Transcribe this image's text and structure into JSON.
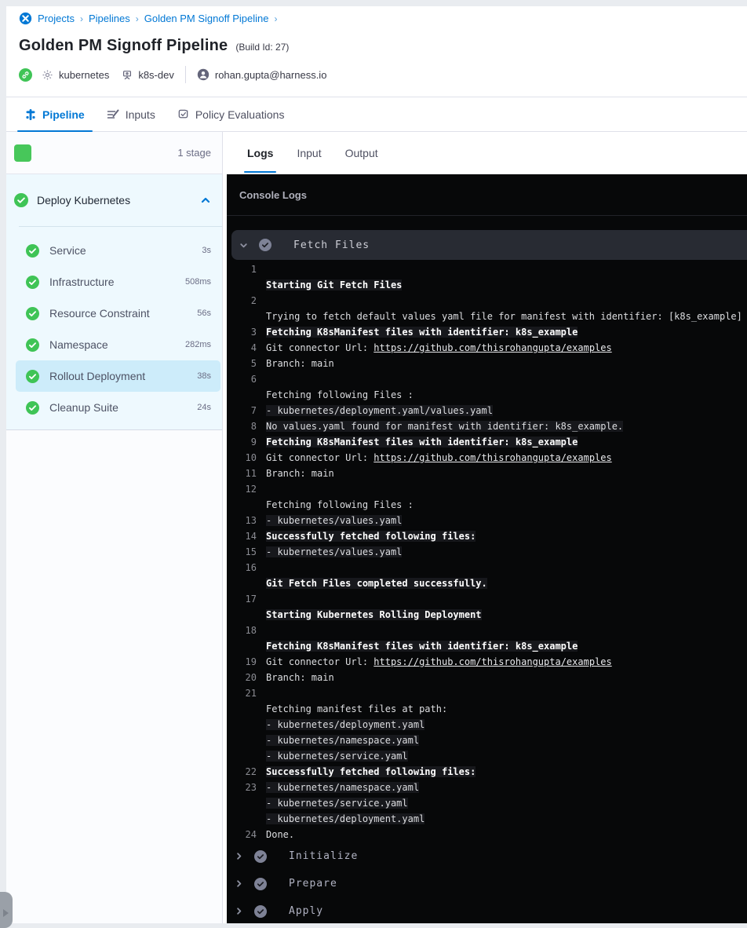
{
  "breadcrumb": {
    "separator": "›",
    "items": [
      "Projects",
      "Pipelines",
      "Golden PM Signoff Pipeline"
    ]
  },
  "header": {
    "title": "Golden PM Signoff Pipeline",
    "build_id": "(Build Id: 27)",
    "service": "kubernetes",
    "environment": "k8s-dev",
    "user": "rohan.gupta@harness.io"
  },
  "tabs": [
    {
      "label": "Pipeline",
      "active": true
    },
    {
      "label": "Inputs",
      "active": false
    },
    {
      "label": "Policy Evaluations",
      "active": false
    }
  ],
  "execution": {
    "stage_count_label": "1 stage"
  },
  "sidebar": {
    "stage_name": "Deploy Kubernetes",
    "stage_status": "success",
    "steps": [
      {
        "label": "Service",
        "duration": "3s",
        "status": "success",
        "selected": false
      },
      {
        "label": "Infrastructure",
        "duration": "508ms",
        "status": "success",
        "selected": false
      },
      {
        "label": "Resource Constraint",
        "duration": "56s",
        "status": "success",
        "selected": false
      },
      {
        "label": "Namespace",
        "duration": "282ms",
        "status": "success",
        "selected": false
      },
      {
        "label": "Rollout Deployment",
        "duration": "38s",
        "status": "success",
        "selected": true
      },
      {
        "label": "Cleanup Suite",
        "duration": "24s",
        "status": "success",
        "selected": false
      }
    ]
  },
  "log_tabs": [
    {
      "label": "Logs",
      "active": true
    },
    {
      "label": "Input",
      "active": false
    },
    {
      "label": "Output",
      "active": false
    }
  ],
  "console": {
    "title": "Console Logs",
    "sections": [
      {
        "label": "Fetch Files",
        "state": "expanded",
        "status": "success",
        "lines": [
          {
            "n": "1",
            "seg": []
          },
          {
            "n": "",
            "seg": [
              {
                "s": "b",
                "t": "Starting Git Fetch Files"
              }
            ]
          },
          {
            "n": "2",
            "seg": []
          },
          {
            "n": "",
            "seg": [
              {
                "s": "p",
                "t": "Trying to fetch default values yaml file for manifest with identifier: [k8s_example]"
              }
            ]
          },
          {
            "n": "3",
            "seg": [
              {
                "s": "b",
                "t": "Fetching K8sManifest files with identifier: k8s_example"
              }
            ]
          },
          {
            "n": "4",
            "seg": [
              {
                "s": "p",
                "t": "Git connector Url: "
              },
              {
                "s": "l",
                "t": "https://github.com/thisrohangupta/examples"
              }
            ]
          },
          {
            "n": "5",
            "seg": [
              {
                "s": "p",
                "t": "Branch: main"
              }
            ]
          },
          {
            "n": "6",
            "seg": []
          },
          {
            "n": "",
            "seg": [
              {
                "s": "p",
                "t": "Fetching following Files :"
              }
            ]
          },
          {
            "n": "7",
            "seg": [
              {
                "s": "h",
                "t": "- kubernetes/deployment.yaml/values.yaml"
              }
            ]
          },
          {
            "n": "8",
            "seg": [
              {
                "s": "h",
                "t": "No values.yaml found for manifest with identifier: k8s_example."
              }
            ]
          },
          {
            "n": "9",
            "seg": [
              {
                "s": "b",
                "t": "Fetching K8sManifest files with identifier: k8s_example"
              }
            ]
          },
          {
            "n": "10",
            "seg": [
              {
                "s": "p",
                "t": "Git connector Url: "
              },
              {
                "s": "l",
                "t": "https://github.com/thisrohangupta/examples"
              }
            ]
          },
          {
            "n": "11",
            "seg": [
              {
                "s": "p",
                "t": "Branch: main"
              }
            ]
          },
          {
            "n": "12",
            "seg": []
          },
          {
            "n": "",
            "seg": [
              {
                "s": "p",
                "t": "Fetching following Files :"
              }
            ]
          },
          {
            "n": "13",
            "seg": [
              {
                "s": "h",
                "t": "- kubernetes/values.yaml"
              }
            ]
          },
          {
            "n": "14",
            "seg": [
              {
                "s": "b",
                "t": "Successfully fetched following files:"
              }
            ]
          },
          {
            "n": "15",
            "seg": [
              {
                "s": "h",
                "t": "- kubernetes/values.yaml"
              }
            ]
          },
          {
            "n": "16",
            "seg": []
          },
          {
            "n": "",
            "seg": [
              {
                "s": "b",
                "t": "Git Fetch Files completed successfully."
              }
            ]
          },
          {
            "n": "17",
            "seg": []
          },
          {
            "n": "",
            "seg": [
              {
                "s": "b",
                "t": "Starting Kubernetes Rolling Deployment"
              }
            ]
          },
          {
            "n": "18",
            "seg": []
          },
          {
            "n": "",
            "seg": [
              {
                "s": "b",
                "t": "Fetching K8sManifest files with identifier: k8s_example"
              }
            ]
          },
          {
            "n": "19",
            "seg": [
              {
                "s": "p",
                "t": "Git connector Url: "
              },
              {
                "s": "l",
                "t": "https://github.com/thisrohangupta/examples"
              }
            ]
          },
          {
            "n": "20",
            "seg": [
              {
                "s": "p",
                "t": "Branch: main"
              }
            ]
          },
          {
            "n": "21",
            "seg": []
          },
          {
            "n": "",
            "seg": [
              {
                "s": "p",
                "t": "Fetching manifest files at path:"
              }
            ]
          },
          {
            "n": "",
            "seg": [
              {
                "s": "h",
                "t": "- kubernetes/deployment.yaml"
              }
            ]
          },
          {
            "n": "",
            "seg": [
              {
                "s": "h",
                "t": "- kubernetes/namespace.yaml"
              }
            ]
          },
          {
            "n": "",
            "seg": [
              {
                "s": "h",
                "t": "- kubernetes/service.yaml"
              }
            ]
          },
          {
            "n": "22",
            "seg": [
              {
                "s": "b",
                "t": "Successfully fetched following files:"
              }
            ]
          },
          {
            "n": "23",
            "seg": [
              {
                "s": "h",
                "t": "- kubernetes/namespace.yaml"
              }
            ]
          },
          {
            "n": "",
            "seg": [
              {
                "s": "h",
                "t": "- kubernetes/service.yaml"
              }
            ]
          },
          {
            "n": "",
            "seg": [
              {
                "s": "h",
                "t": "- kubernetes/deployment.yaml"
              }
            ]
          },
          {
            "n": "24",
            "seg": [
              {
                "s": "p",
                "t": "Done."
              }
            ]
          }
        ]
      },
      {
        "label": "Initialize",
        "state": "collapsed",
        "status": "success",
        "lines": []
      },
      {
        "label": "Prepare",
        "state": "collapsed",
        "status": "success",
        "lines": []
      },
      {
        "label": "Apply",
        "state": "collapsed",
        "status": "success",
        "lines": []
      }
    ]
  },
  "colors": {
    "accent_blue": "#0278d5",
    "success_green": "#3fc456",
    "stage_square_green": "#47c75a",
    "sidebar_bg": "#eef9fe",
    "selected_step_bg": "#cdecfa",
    "console_bg": "#070809",
    "section_bar_bg": "#282b33",
    "log_highlight_bg": "#17181c"
  }
}
